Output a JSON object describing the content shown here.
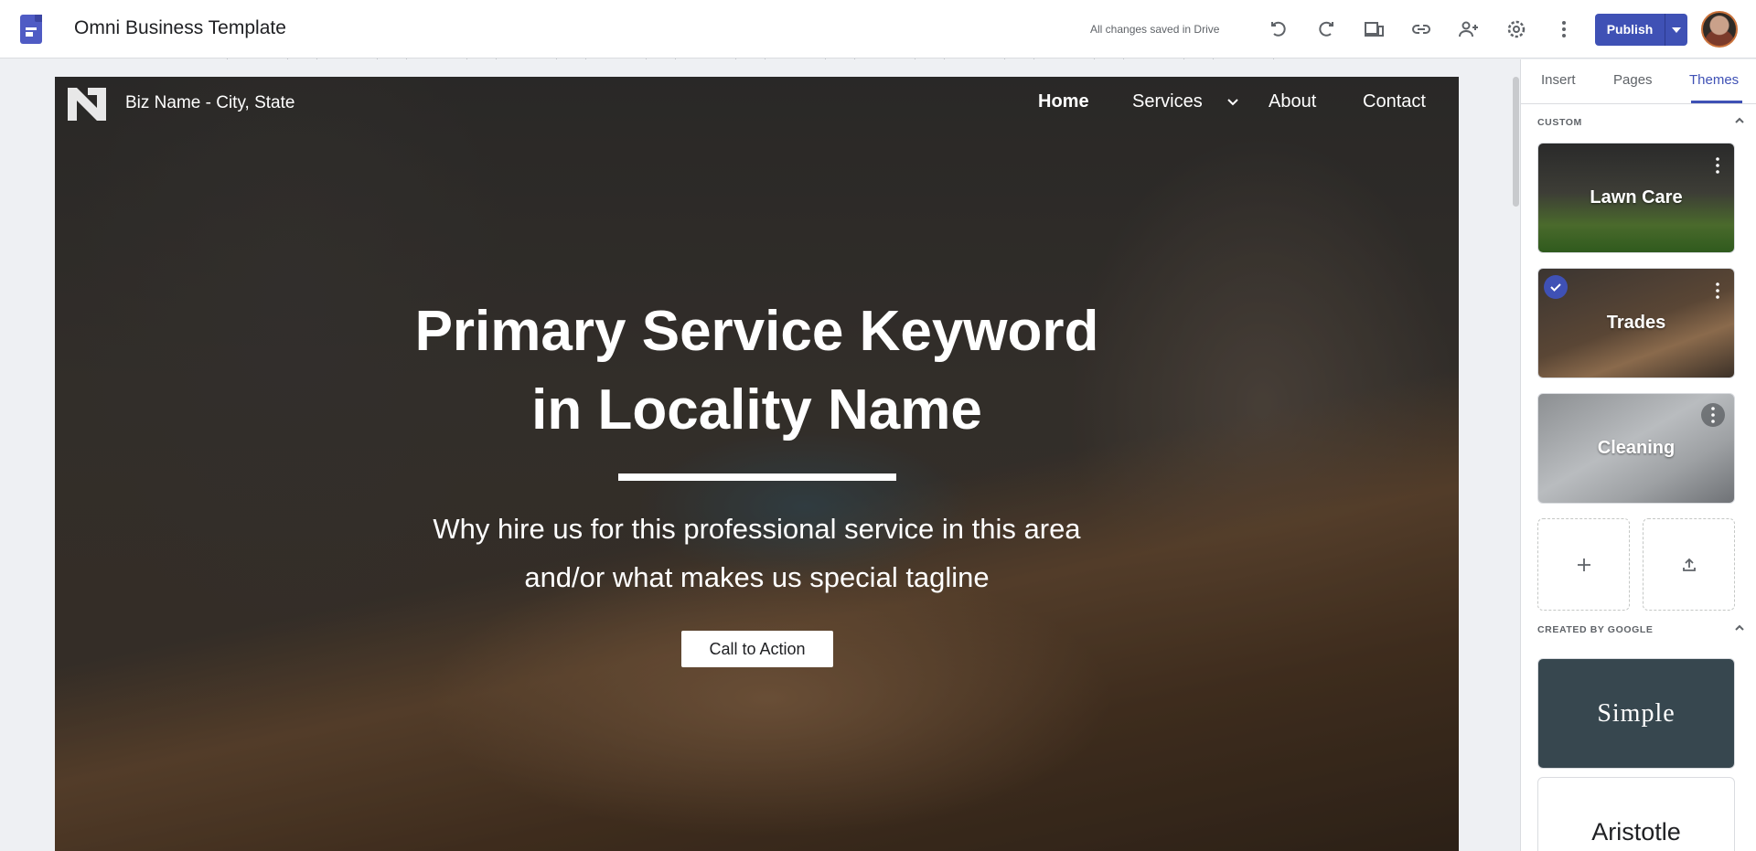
{
  "app": {
    "doc_title": "Omni Business Template",
    "save_status": "All changes saved in Drive",
    "publish_label": "Publish"
  },
  "toolbar": {
    "icons": [
      "undo-icon",
      "redo-icon",
      "preview-devices-icon",
      "link-icon",
      "share-person-icon",
      "settings-gear-icon",
      "more-vert-icon",
      "publish-dropdown-icon"
    ]
  },
  "site": {
    "biz_name": "Biz Name - City, State",
    "nav": {
      "home": "Home",
      "services": "Services",
      "about": "About",
      "contact": "Contact"
    },
    "hero": {
      "title_line1": "Primary Service Keyword",
      "title_line2": "in Locality Name",
      "subtitle_line1": "Why hire us for this professional service in this area",
      "subtitle_line2": "and/or what makes us special tagline",
      "cta_label": "Call to Action"
    }
  },
  "panel": {
    "tabs": {
      "insert": "Insert",
      "pages": "Pages",
      "themes": "Themes"
    },
    "active_tab": "Themes",
    "custom_section_label": "CUSTOM",
    "google_section_label": "CREATED BY GOOGLE",
    "custom_themes": [
      {
        "name": "Lawn Care",
        "selected": false
      },
      {
        "name": "Trades",
        "selected": true
      },
      {
        "name": "Cleaning",
        "selected": false
      }
    ],
    "google_themes": [
      {
        "name": "Simple"
      },
      {
        "name": "Aristotle"
      }
    ]
  },
  "colors": {
    "accent": "#3f51b5",
    "simple_theme_bg": "#37474f",
    "aristotle_accent": "#e0a13b"
  }
}
